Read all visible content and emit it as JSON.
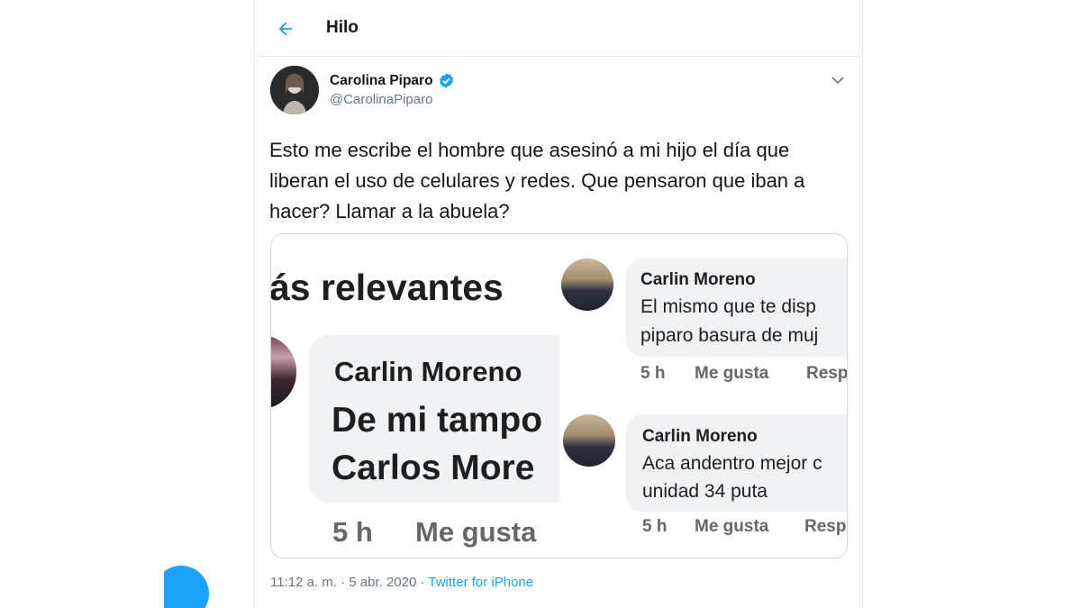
{
  "header": {
    "title": "Hilo",
    "back_icon": "back-arrow-icon"
  },
  "tweet": {
    "author_name": "Carolina Piparo",
    "author_handle": "@CarolinaPiparo",
    "verified": true,
    "text": "Esto me escribe el hombre que asesinó a mi hijo el día que liberan el uso de celulares y redes. Que pensaron que iban a hacer? Llamar a la abuela?",
    "timestamp": "11:12 a. m. · 5 abr. 2020 · ",
    "source": "Twitter for iPhone"
  },
  "media": {
    "left": {
      "heading": "ás relevantes",
      "name": "Carlin Moreno",
      "line1": "De mi tampo",
      "line2": "Carlos More",
      "time": "5 h",
      "like": "Me gusta"
    },
    "comments": [
      {
        "name": "Carlin Moreno",
        "line1": "El mismo que te disp",
        "line2": "piparo basura de muj",
        "time": "5 h",
        "like": "Me gusta",
        "reply": "Resp"
      },
      {
        "name": "Carlin Moreno",
        "line1": "Aca andentro mejor c",
        "line2": "unidad 34 puta",
        "time": "5 h",
        "like": "Me gusta",
        "reply": "Resp"
      }
    ]
  },
  "colors": {
    "accent": "#1da1f2",
    "text": "#14171a",
    "muted": "#657786",
    "fb_bubble": "#f0f2f5"
  }
}
